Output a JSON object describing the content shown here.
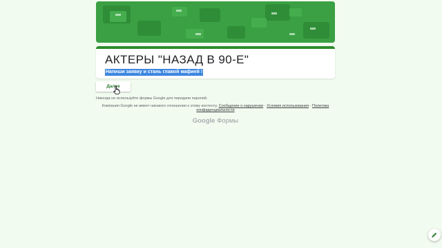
{
  "form": {
    "title": "АКТЕРЫ \"НАЗАД В 90-Е\"",
    "description": "Напиши заявку и стань главой мафией !"
  },
  "actions": {
    "next_label": "Далее"
  },
  "footer": {
    "password_note": "Никогда не используйте формы Google для передачи паролей.",
    "disclaimer_text": "Компания Google не имеет никакого отношения к этому контенту.",
    "report_abuse_link": "Сообщение о нарушении",
    "separator_1": " - ",
    "terms_link": "Условия использования",
    "separator_2": " - ",
    "privacy_link": "Политика конфиденциальности",
    "brand_google": "Google",
    "brand_forms": "Формы"
  },
  "colors": {
    "header_green": "#3aa043",
    "accent_green": "#2e8b2e",
    "page_background": "#f2fbef",
    "selection_blue": "#3d86e0"
  },
  "icons": {
    "cursor": "hand-pointer-icon",
    "edit": "pencil-icon"
  }
}
